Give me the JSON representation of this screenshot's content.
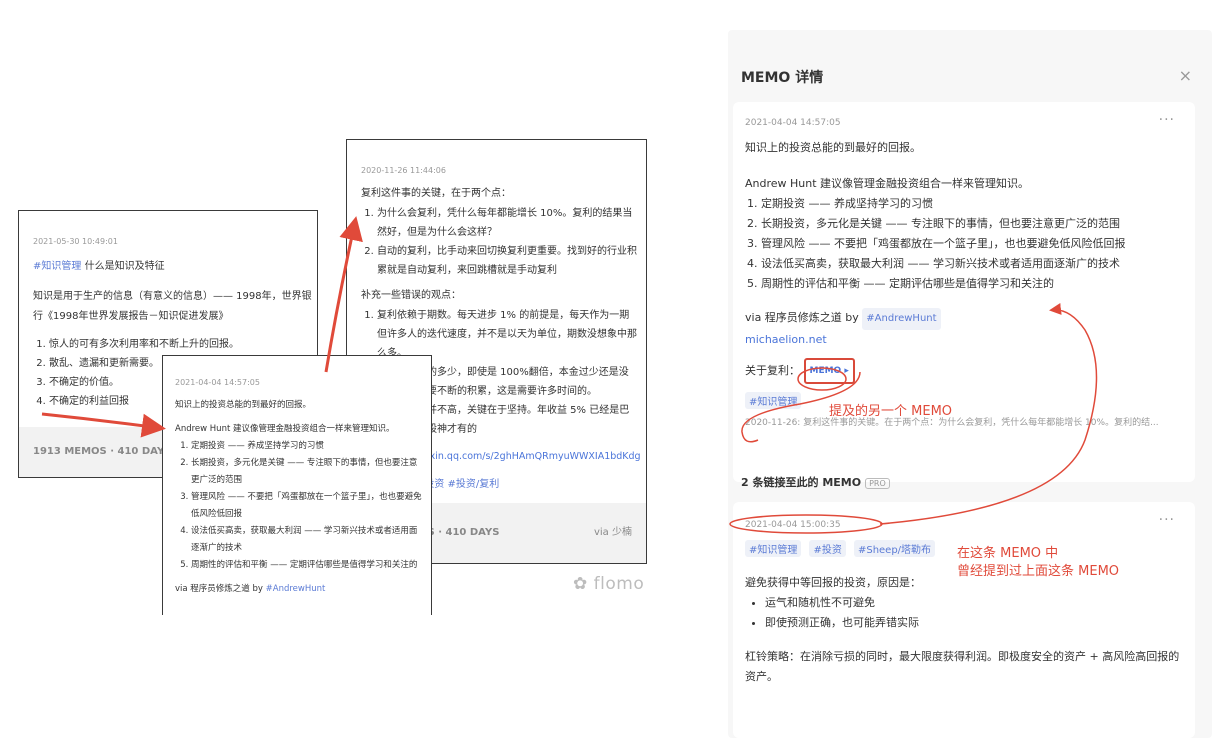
{
  "card1": {
    "timestamp": "2021-05-30 10:49:01",
    "tag": "#知识管理",
    "title_rest": " 什么是知识及特征",
    "para": "知识是用于生产的信息（有意义的信息）—— 1998年，世界银行《1998年世界发展报告－知识促进发展》",
    "list": [
      "惊人的可有多次利用率和不断上升的回报。",
      "散乱、遗漏和更新需要。",
      "不确定的价值。",
      "不确定的利益回报"
    ],
    "footer": "1913 MEMOS · 410 DAYS"
  },
  "card2": {
    "timestamp": "2021-04-04 14:57:05",
    "line1": "知识上的投资总能的到最好的回报。",
    "line2": "Andrew Hunt 建议像管理金融投资组合一样来管理知识。",
    "list": [
      "定期投资 —— 养成坚持学习的习惯",
      "长期投资，多元化是关键 —— 专注眼下的事情，但也要注意更广泛的范围",
      "管理风险 —— 不要把「鸡蛋都放在一个篮子里」，也也要避免低风险低回报",
      "设法低买高卖，获取最大利润 —— 学习新兴技术或者适用面逐渐广的技术",
      "周期性的评估和平衡 —— 定期评估哪些是值得学习和关注的"
    ],
    "via_prefix": "via 程序员修炼之道 by ",
    "via_tag": "#AndrewHunt"
  },
  "card3": {
    "timestamp": "2020-11-26 11:44:06",
    "heading": "复利这件事的关键，在于两个点：",
    "list1": [
      "为什么会复利，凭什么每年都能增长 10%。复利的结果当然好，但是为什么会这样？",
      "自动的复利，比手动来回切换复利更重要。找到好的行业积累就是自动复利，来回跳槽就是手动复利"
    ],
    "heading2": "补充一些错误的观点：",
    "list2": [
      "复利依赖于期数。每天进步 1% 的前提是，每天作为一期但许多人的迭代速度，并不是以天为单位，期数没想象中那么多。",
      "依赖于本金的多少，即使是 100%翻倍，本金过少还是没有意义。需要不断的积累，这是需要许多时间的。",
      "收益率其实并不高，关键在于坚持。年收益 5% 已经是巴菲特级别的股神才有的"
    ],
    "url": "https://mp.weixin.qq.com/s/2ghHAmQRmyuWWXIA1bdKdg",
    "tags": "#朋友/孟岩 #投资 #投资/复利",
    "footer": "1913 MEMOS · 410 DAYS",
    "via": "via 少楠"
  },
  "brand": "flomo",
  "panel": {
    "title": "MEMO 详情",
    "close": "×",
    "memo1": {
      "timestamp": "2021-04-04 14:57:05",
      "more": "···",
      "line1": "知识上的投资总能的到最好的回报。",
      "line2": "Andrew Hunt 建议像管理金融投资组合一样来管理知识。",
      "list": [
        "定期投资 —— 养成坚持学习的习惯",
        "长期投资，多元化是关键 —— 专注眼下的事情，但也要注意更广泛的范围",
        "管理风险 —— 不要把「鸡蛋都放在一个篮子里」，也也要避免低风险低回报",
        "设法低买高卖，获取最大利润 —— 学习新兴技术或者适用面逐渐广的技术",
        "周期性的评估和平衡 —— 定期评估哪些是值得学习和关注的"
      ],
      "via_prefix": "via 程序员修炼之道 by ",
      "via_tag": "#AndrewHunt",
      "site": "michaelion.net",
      "ref_label": "关于复利：",
      "ref_chip": "MEMO ▸",
      "tag": "#知识管理",
      "quote": "2020-11-26: 复利这件事的关键。在于两个点：为什么会复利，凭什么每年都能增长 10%。复利的结..."
    },
    "linked_header": "2 条链接至此的 MEMO",
    "pro": "PRO",
    "memo2": {
      "timestamp": "2021-04-04 15:00:35",
      "more": "···",
      "tags": [
        "#知识管理",
        "#投资",
        "#Sheep/塔勒布"
      ],
      "line1": "避免获得中等回报的投资，原因是：",
      "bullets": [
        "运气和随机性不可避免",
        "即使预测正确，也可能弄错实际"
      ],
      "line2": "杠铃策略：在消除亏损的同时，最大限度获得利润。即极度安全的资产 + 高风险高回报的资产。"
    }
  },
  "annotations": {
    "a1": "提及的另一个 MEMO",
    "a2_line1": "在这条 MEMO 中",
    "a2_line2": "曾经提到过上面这条 MEMO"
  }
}
